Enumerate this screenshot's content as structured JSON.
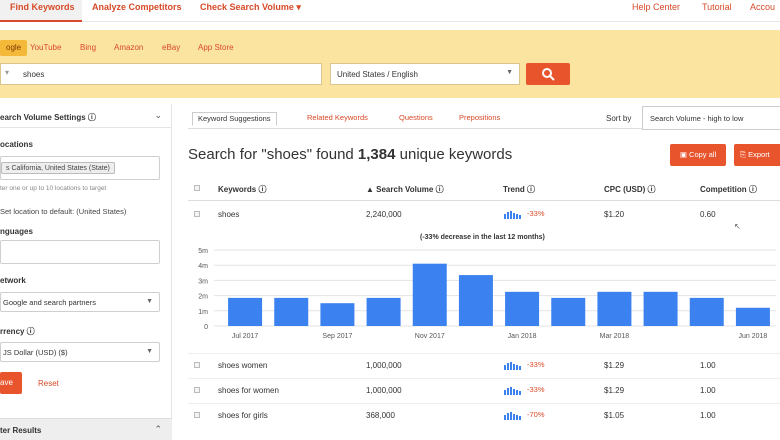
{
  "topnav": {
    "find_keywords": "Find Keywords",
    "analyze_competitors": "Analyze Competitors",
    "check_search_volume": "Check Search Volume ▾",
    "help_center": "Help Center",
    "tutorial": "Tutorial",
    "account": "Accou"
  },
  "source_tabs": [
    "ogle",
    "YouTube",
    "Bing",
    "Amazon",
    "eBay",
    "App Store"
  ],
  "search": {
    "value": "shoes",
    "location": "United States / English"
  },
  "sidebar": {
    "title": "earch Volume Settings ⓘ",
    "locations_label": "ocations",
    "location_chip": "s California, United States (State)",
    "locations_hint": "ter one or up to 10 locations to target",
    "set_default": "Set location to default: (United States)",
    "languages_label": "nguages",
    "network_label": "etwork",
    "network_value": "Google and search partners",
    "currency_label": "rrency ⓘ",
    "currency_value": "JS Dollar (USD) ($)",
    "save_label": "ave",
    "reset_label": "Reset",
    "filter_label": "ter Results"
  },
  "subtabs": [
    "Keyword Suggestions",
    "Related Keywords",
    "Questions",
    "Prepositions"
  ],
  "sort": {
    "label": "Sort by",
    "value": "Search Volume - high to low"
  },
  "result": {
    "prefix": "Search for \"shoes\" found ",
    "count": "1,384",
    "suffix": " unique keywords"
  },
  "buttons": {
    "copy_all": "Copy all",
    "export": "Export"
  },
  "table": {
    "headers": [
      "Keywords ⓘ",
      "▲ Search Volume ⓘ",
      "Trend ⓘ",
      "CPC (USD) ⓘ",
      "Competition ⓘ"
    ],
    "rows": [
      {
        "keyword": "shoes",
        "volume": "2,240,000",
        "trend": "-33%",
        "cpc": "$1.20",
        "competition": "0.60"
      },
      {
        "keyword": "shoes women",
        "volume": "1,000,000",
        "trend": "-33%",
        "cpc": "$1.29",
        "competition": "1.00"
      },
      {
        "keyword": "shoes for women",
        "volume": "1,000,000",
        "trend": "-33%",
        "cpc": "$1.29",
        "competition": "1.00"
      },
      {
        "keyword": "shoes for girls",
        "volume": "368,000",
        "trend": "-70%",
        "cpc": "$1.05",
        "competition": "1.00"
      }
    ]
  },
  "colors": {
    "accent": "#e8542c",
    "band": "#fbe3a0",
    "bar": "#3b82f0"
  },
  "chart_data": {
    "type": "bar",
    "title": "(-33% decrease in the last 12 months)",
    "categories": [
      "Jul 2017",
      "Aug 2017",
      "Sep 2017",
      "Oct 2017",
      "Nov 2017",
      "Dec 2017",
      "Jan 2018",
      "Feb 2018",
      "Mar 2018",
      "Apr 2018",
      "May 2018",
      "Jun 2018"
    ],
    "category_labels_shown": [
      "Jul 2017",
      "",
      "Sep 2017",
      "",
      "Nov 2017",
      "",
      "Jan 2018",
      "",
      "Mar 2018",
      "",
      "",
      "Jun 2018"
    ],
    "values": [
      1.85,
      1.85,
      1.5,
      1.85,
      4.1,
      3.35,
      2.25,
      1.85,
      2.25,
      2.25,
      1.85,
      1.2
    ],
    "yticks": [
      "0",
      "1m",
      "2m",
      "3m",
      "4m",
      "5m"
    ],
    "ylim": [
      0,
      5
    ],
    "grid": true
  }
}
